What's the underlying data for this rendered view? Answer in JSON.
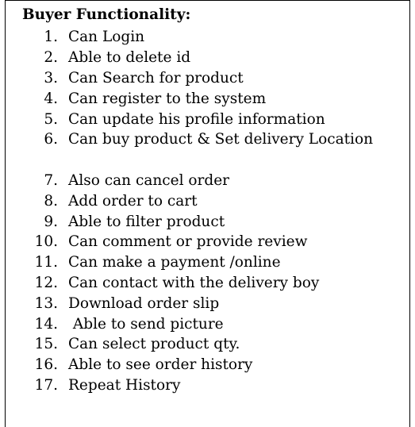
{
  "document": {
    "title": "Buyer Functionality:",
    "items": [
      {
        "number": "1.",
        "text": "Can Login"
      },
      {
        "number": "2.",
        "text": "Able to delete id"
      },
      {
        "number": "3.",
        "text": "Can Search for product"
      },
      {
        "number": "4.",
        "text": "Can register to the system"
      },
      {
        "number": "5.",
        "text": "Can update his profile information"
      },
      {
        "number": "6.",
        "text": "Can buy product & Set delivery Location"
      },
      {
        "number": "7.",
        "text": "Also can cancel order"
      },
      {
        "number": "8.",
        "text": "Add order to cart"
      },
      {
        "number": "9.",
        "text": "Able to filter product"
      },
      {
        "number": "10.",
        "text": "Can comment or provide review"
      },
      {
        "number": "11.",
        "text": "Can make a payment /online"
      },
      {
        "number": "12.",
        "text": "Can contact with the delivery boy"
      },
      {
        "number": "13.",
        "text": "Download order slip"
      },
      {
        "number": "14.",
        "text": " Able to send picture"
      },
      {
        "number": "15.",
        "text": "Can select product qty."
      },
      {
        "number": "16.",
        "text": "Able to see order history"
      },
      {
        "number": "17.",
        "text": "Repeat History"
      }
    ]
  }
}
